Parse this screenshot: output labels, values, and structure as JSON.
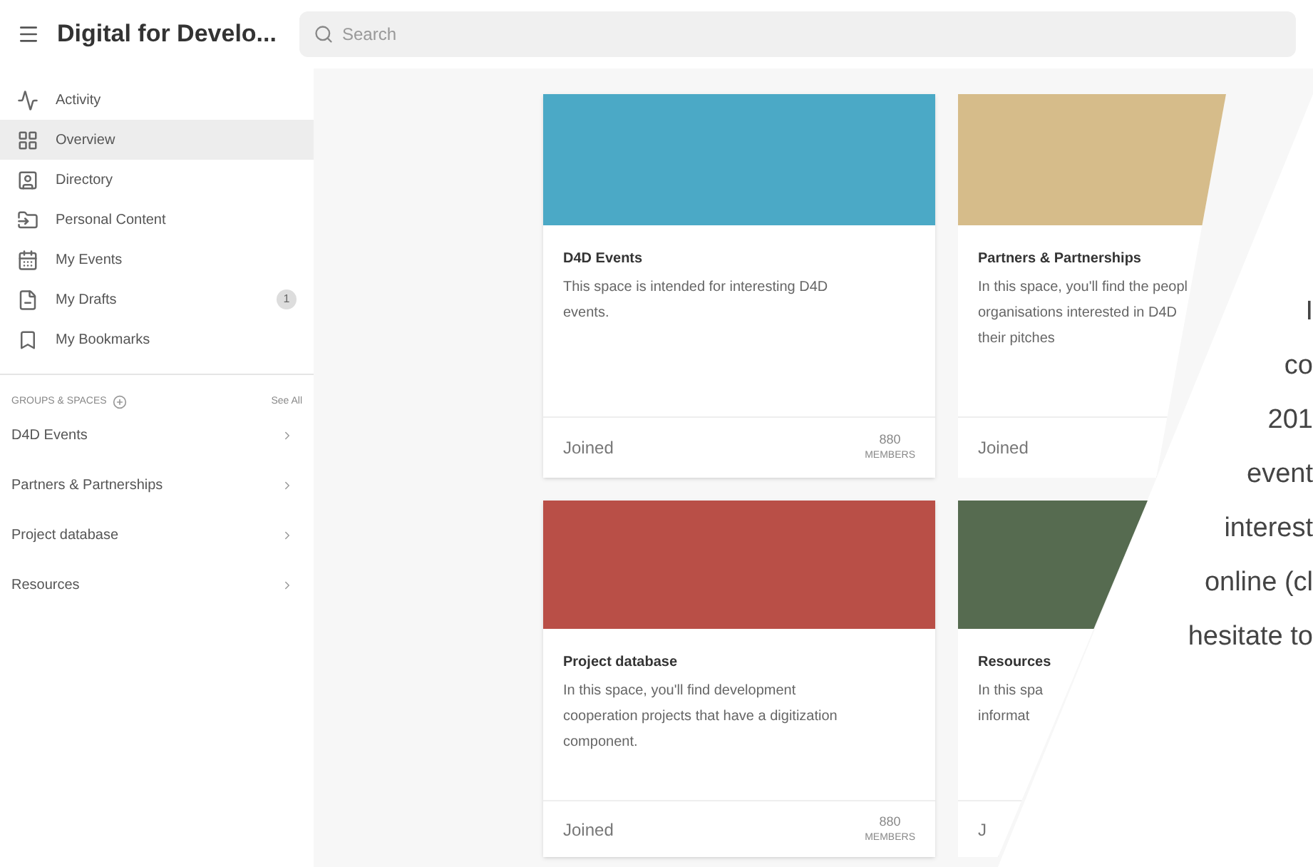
{
  "header": {
    "title": "Digital for Develo...",
    "search": {
      "placeholder": "Search"
    }
  },
  "sidebar": {
    "items": [
      {
        "label": "Activity",
        "selected": false
      },
      {
        "label": "Overview",
        "selected": true
      },
      {
        "label": "Directory",
        "selected": false
      },
      {
        "label": "Personal Content",
        "selected": false
      },
      {
        "label": "My Events",
        "selected": false
      },
      {
        "label": "My Drafts",
        "selected": false,
        "badge": "1"
      },
      {
        "label": "My Bookmarks",
        "selected": false
      }
    ],
    "groups_heading": "GROUPS & SPACES",
    "see_all": "See All",
    "groups": [
      "D4D Events",
      "Partners & Partnerships",
      "Project database",
      "Resources"
    ]
  },
  "cards": [
    {
      "color": "#4ba9c6",
      "title": "D4D Events",
      "description_lines": [
        "This space is intended for interesting D4D",
        "events."
      ],
      "status": "Joined",
      "members_count": "880",
      "members_label": "MEMBERS"
    },
    {
      "color": "#d6bc8a",
      "title": "Partners & Partnerships",
      "description_lines": [
        "In this space, you'll find the peopl",
        "organisations interested in D4D",
        "their pitches"
      ],
      "status": "Joined"
    },
    {
      "color": "#b94f47",
      "title": "Project database",
      "description_lines": [
        "In this space, you'll find development",
        "cooperation projects that have a digitization",
        "component."
      ],
      "status": "Joined",
      "members_count": "880",
      "members_label": "MEMBERS"
    },
    {
      "color": "#566b50",
      "title": "Resources",
      "description_lines": [
        "In this spa",
        "informat"
      ],
      "status": "J"
    }
  ],
  "overlay_lines": [
    "I",
    "co",
    "201",
    "event",
    "interest",
    "online (cl",
    "hesitate to"
  ]
}
